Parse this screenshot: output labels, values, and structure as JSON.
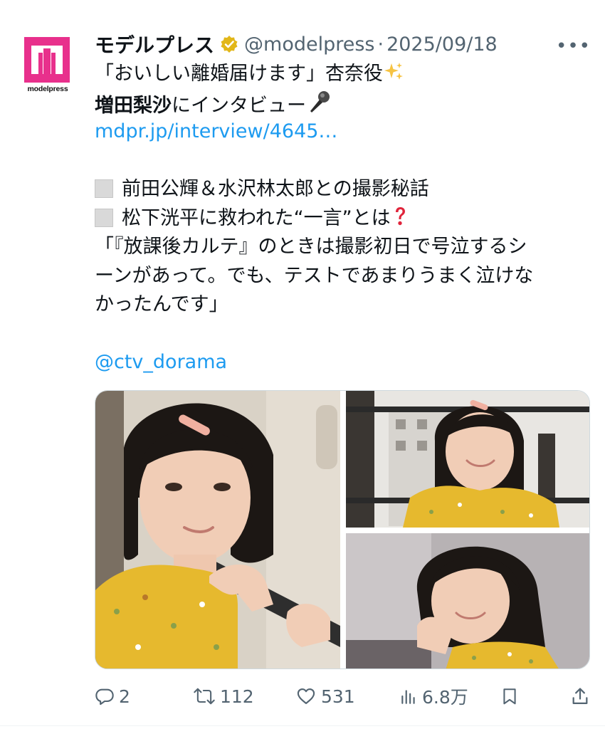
{
  "account": {
    "avatar_brand": "modelpress",
    "display_name": "モデルプレス",
    "handle": "@modelpress",
    "separator": "·",
    "date": "2025/09/18",
    "verified_color": "#e2b719"
  },
  "more_menu": "•••",
  "tweet": {
    "line1": "「おいしい離婚届けます」杏奈役",
    "line2_bold": "増田梨沙",
    "line2_rest": "にインタビュー",
    "link": "mdpr.jp/interview/4645…",
    "bullet1": "前田公輝＆水沢林太郎との撮影秘話",
    "bullet2": "松下洸平に救われた“一言”とは",
    "quote1": "「『放課後カルテ』のときは撮影初日で号泣するシ",
    "quote2": "ーンがあって。でも、テストであまりうまく泣けな",
    "quote3": "かったんです」",
    "mention": "@ctv_dorama"
  },
  "actions": {
    "replies": "2",
    "retweets": "112",
    "likes": "531",
    "views": "6.8万"
  },
  "colors": {
    "brand": "#e8308c",
    "link": "#1d9bf0",
    "muted": "#536471"
  }
}
